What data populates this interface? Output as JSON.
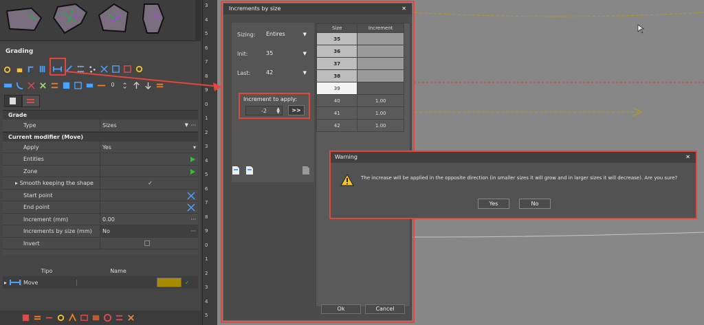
{
  "grading": {
    "title": "Grading",
    "tab_icons": [
      "pattern-piece-tab-icon",
      "grading-rule-tab-icon"
    ]
  },
  "props": {
    "sections": {
      "grade": "Grade",
      "modifier": "Current modifier (Move)"
    },
    "type_label": "Type",
    "type_value": "Sizes",
    "apply_label": "Apply",
    "apply_value": "Yes",
    "entities_label": "Entities",
    "zone_label": "Zone",
    "smooth_label": "Smooth keeping the shape",
    "smooth_value": "✓",
    "start_label": "Start point",
    "end_label": "End point",
    "increment_label": "Increment (mm)",
    "increment_value": "0.00",
    "incbysize_label": "Increments by size (mm)",
    "incbysize_value": "No",
    "invert_label": "Invert"
  },
  "grid": {
    "col_tipo": "Tipo",
    "col_name": "Name",
    "row_name": "Move"
  },
  "toolbar": {
    "spin_value": "0"
  },
  "ruler": {
    "ticks": [
      "3",
      "4",
      "5",
      "6",
      "7",
      "8",
      "9",
      "0",
      "1",
      "2",
      "3",
      "4",
      "5",
      "6",
      "7",
      "8",
      "9",
      "0",
      "1",
      "2",
      "3",
      "4",
      "5"
    ]
  },
  "inc": {
    "title": "Increments by size",
    "sizing_label": "Sizing:",
    "sizing_value": "Entires",
    "init_label": "Init:",
    "init_value": "35",
    "last_label": "Last:",
    "last_value": "42",
    "group_label": "Increment to apply:",
    "spin_value": "-2",
    "apply_label": ">>",
    "table": {
      "headers": [
        "Size",
        "Increment"
      ],
      "rows": [
        {
          "size": "35",
          "inc": ""
        },
        {
          "size": "36",
          "inc": ""
        },
        {
          "size": "37",
          "inc": ""
        },
        {
          "size": "38",
          "inc": ""
        },
        {
          "size": "39",
          "inc": ""
        },
        {
          "size": "40",
          "inc": "1.00"
        },
        {
          "size": "41",
          "inc": "1.00"
        },
        {
          "size": "42",
          "inc": "1.00"
        }
      ]
    },
    "ok": "Ok",
    "cancel": "Cancel"
  },
  "warn": {
    "title": "Warning",
    "message": "The increase will be applied in the opposite direction (in smaller sizes it will grow and in larger sizes it will decrease). Are you sure?",
    "yes": "Yes",
    "no": "No"
  },
  "colors": {
    "highlight": "#e4463a",
    "canvas": "#878787",
    "guide": "#b89a1e"
  }
}
